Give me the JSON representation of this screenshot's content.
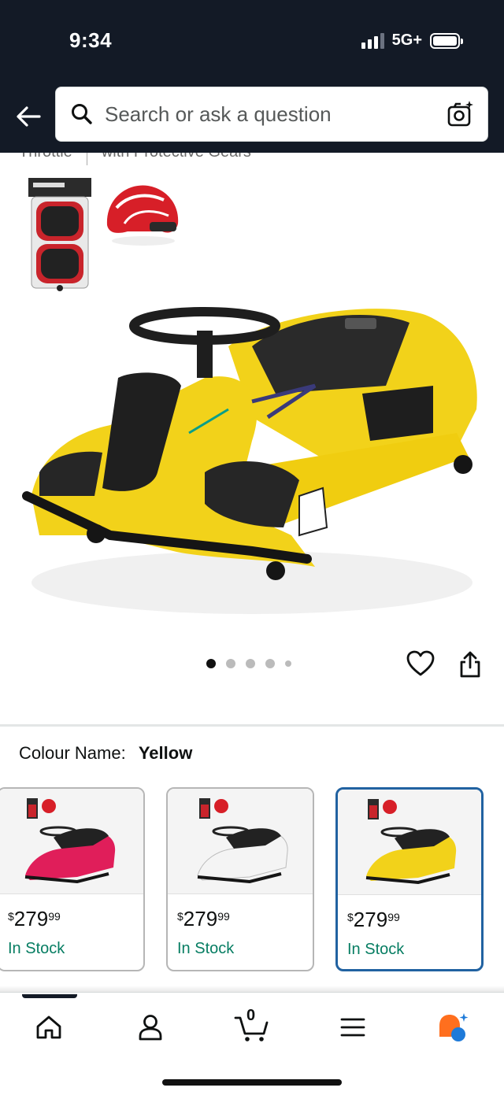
{
  "status_bar": {
    "time": "9:34",
    "network": "5G+"
  },
  "search": {
    "placeholder": "Search or ask a question"
  },
  "product": {
    "cut_off_text_left": "Throttle",
    "cut_off_text_right": "with Protective Gears",
    "image_count": 5,
    "active_image_index": 0
  },
  "colour": {
    "label": "Colour Name:",
    "selected": "Yellow"
  },
  "variants": [
    {
      "color": "pink",
      "price_symbol": "$",
      "price_whole": "279",
      "price_cents": "99",
      "stock": "In Stock",
      "selected": false
    },
    {
      "color": "white",
      "price_symbol": "$",
      "price_whole": "279",
      "price_cents": "99",
      "stock": "In Stock",
      "selected": false
    },
    {
      "color": "yellow",
      "price_symbol": "$",
      "price_whole": "279",
      "price_cents": "99",
      "stock": "In Stock",
      "selected": true
    }
  ],
  "nav": {
    "cart_count": "0",
    "icons": [
      "home-icon",
      "account-icon",
      "cart-icon",
      "menu-icon",
      "rufus-icon"
    ]
  },
  "colors": {
    "header_bg": "#131a26",
    "selected_border": "#2162a1",
    "in_stock": "#067d62",
    "kart_yellow": "#f2d21a"
  }
}
